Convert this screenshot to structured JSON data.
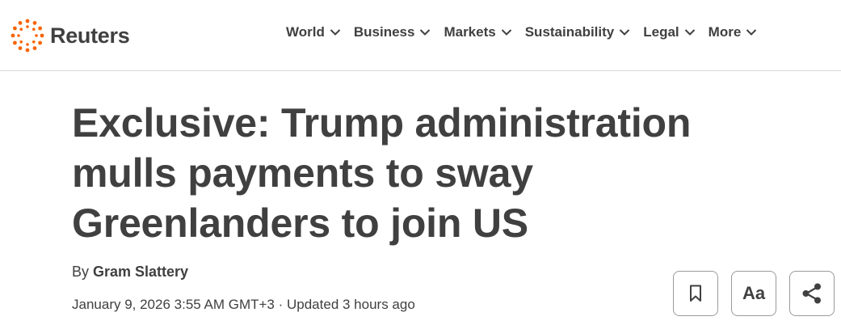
{
  "brand": {
    "name": "Reuters",
    "accent": "#fa6400"
  },
  "nav": {
    "items": [
      {
        "label": "World"
      },
      {
        "label": "Business"
      },
      {
        "label": "Markets"
      },
      {
        "label": "Sustainability"
      },
      {
        "label": "Legal"
      },
      {
        "label": "More"
      }
    ]
  },
  "article": {
    "headline": "Exclusive: Trump administration mulls payments to sway Greenlanders to join US",
    "byline_prefix": "By ",
    "author": "Gram Slattery",
    "dateline": "January 9, 2026 3:55 AM GMT+3 · Updated 3 hours ago"
  },
  "tools": {
    "text_size_label": "Aa",
    "icons": [
      "bookmark-icon",
      "text-size-icon",
      "share-icon"
    ]
  }
}
